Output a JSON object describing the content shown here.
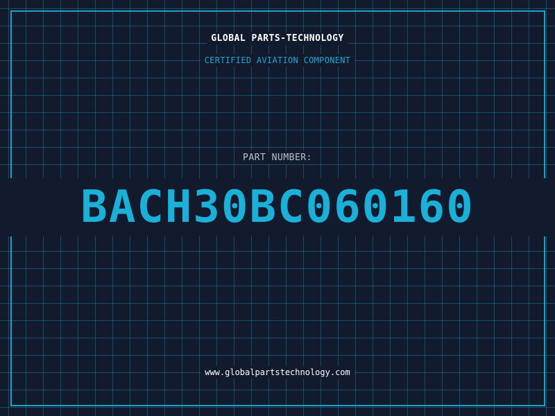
{
  "header": {
    "company_name": "GLOBAL PARTS-TECHNOLOGY",
    "subtitle": "CERTIFIED AVIATION COMPONENT"
  },
  "part": {
    "label": "PART NUMBER:",
    "number": "BACH30BC060160"
  },
  "footer": {
    "website": "www.globalpartstechnology.com"
  },
  "colors": {
    "background": "#121a2e",
    "grid": "#2096b4",
    "frame": "#1aa3c8",
    "accent": "#1ab0d8",
    "title_text": "#ffffff",
    "label_text": "#b8c2cc"
  }
}
